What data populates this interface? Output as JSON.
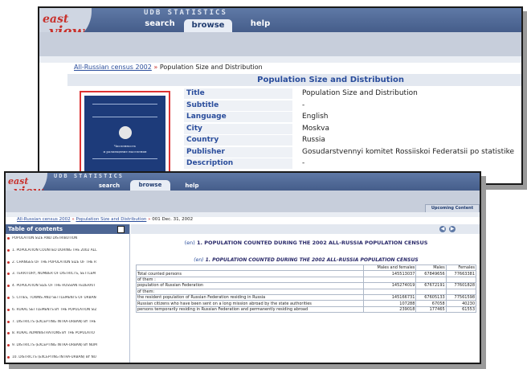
{
  "brand": {
    "udb": "UDB STATISTICS",
    "logo_top": "east",
    "logo_bottom": "view"
  },
  "tabs": {
    "search": "search",
    "browse": "browse",
    "help": "help"
  },
  "window1": {
    "breadcrumb": {
      "link": "All-Russian census 2002",
      "sep": "»",
      "current": "Population Size and Distribution"
    },
    "title": "Population Size and Distribution",
    "cover_text": [
      "Численность",
      "и размещение населения"
    ],
    "metadata": [
      {
        "key": "Title",
        "value": "Population Size and Distribution"
      },
      {
        "key": "Subtitle",
        "value": "-"
      },
      {
        "key": "Language",
        "value": "English"
      },
      {
        "key": "City",
        "value": "Moskva"
      },
      {
        "key": "Country",
        "value": "Russia"
      },
      {
        "key": "Publisher",
        "value": "Gosudarstvennyi komitet Rossiiskoi Federatsii po statistike"
      },
      {
        "key": "Description",
        "value": "-"
      }
    ]
  },
  "window2": {
    "breadcrumb": {
      "link1": "All-Russian census 2002",
      "link2": "Population Size and Distribution",
      "sep": "»",
      "current": "001 Dec. 31, 2002"
    },
    "upcoming": "Upcoming Content",
    "toc_title": "Table of contents",
    "toc_items": [
      "POPULATION SIZE AND DISTRIBUTION",
      "1. POPULATION COUNTED DURING THE 2002 ALL",
      "2. CHANGES OF THE POPULATION SIZE OF THE R",
      "3. TERRITORY, NUMBER OF DISTRICTS, SETTLEM",
      "4. POPULATION SIZE OF THE RUSSIAN FEDERATI",
      "5. CITIES, TOWNS AND SETTLEMENTS OF URBAN",
      "6. RURAL SETTLEMENTS BY THE POPULATION SIZ",
      "7. DISTRICTS (EXCEPTING INTRA-URBAN) BY THE",
      "8. RURAL ADMINISTRATIONS BY THE POPULATIO",
      "9. DISTRICTS (EXCEPTING INTRA-URBAN) BY NUM",
      "10. DISTRICTS (EXCEPTING INTRA-URBAN) BY NU"
    ],
    "en_tag": "(en)",
    "heading": "1. POPULATION COUNTED DURING  THE 2002 ALL-RUSSIA POPULATION CENSUS",
    "subheading": "1. POPULATION COUNTED DURING  THE 2002 ALL-RUSSIA POPULATION CENSUS",
    "table": {
      "columns": [
        "",
        "Males and females",
        "Males",
        "Females"
      ],
      "rows": [
        [
          "Total counted persons",
          "145513037",
          "67849656",
          "77663381"
        ],
        [
          "of them :",
          "",
          "",
          ""
        ],
        [
          "population of Russian Federation",
          "145274019",
          "67672191",
          "77601828"
        ],
        [
          "of them:",
          "",
          "",
          ""
        ],
        [
          "the resident population of Russian Federation residing in Russia",
          "145166731",
          "67605133",
          "77561598"
        ],
        [
          "Russian citizens who have been sent on a long mission abroad by the state authorities",
          "107288",
          "67058",
          "40230"
        ],
        [
          "persons temporarily residing in Russian Federation and permanently residing abroad",
          "239018",
          "177465",
          "61553"
        ]
      ]
    }
  }
}
